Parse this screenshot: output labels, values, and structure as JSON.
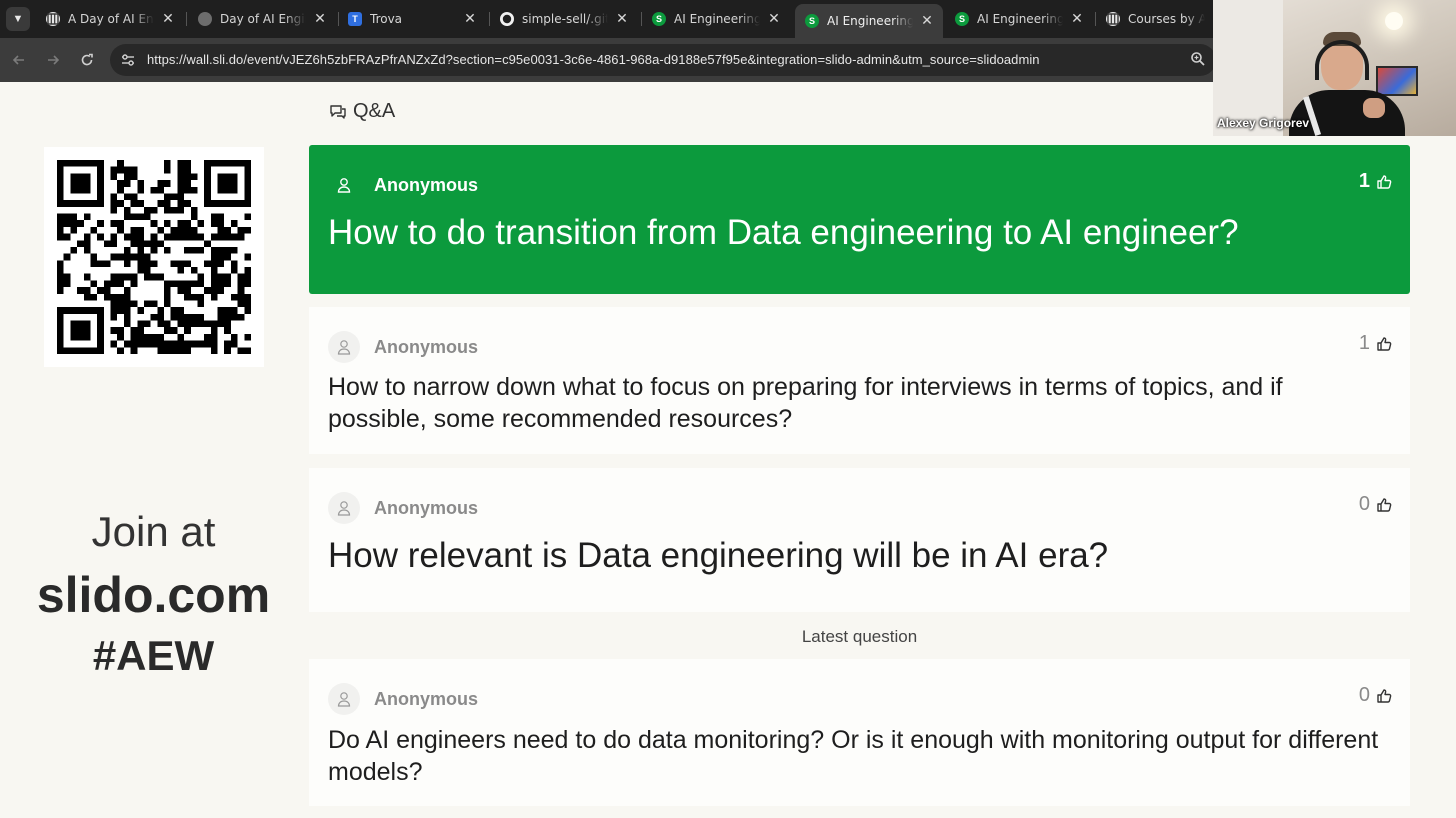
{
  "browser": {
    "tabs": [
      {
        "title": "A Day of AI Engineering",
        "favicon": "globe-grid"
      },
      {
        "title": "Day of AI Engineering",
        "favicon": "globe"
      },
      {
        "title": "Trova",
        "favicon": "T"
      },
      {
        "title": "simple-sell/.github",
        "favicon": "github"
      },
      {
        "title": "AI Engineering workshop",
        "favicon": "S"
      },
      {
        "title": "AI Engineering workshop",
        "favicon": "S"
      },
      {
        "title": "AI Engineering workshop",
        "favicon": "S"
      },
      {
        "title": "Courses by Alexey",
        "favicon": "globe-grid"
      }
    ],
    "url": "https://wall.sli.do/event/vJEZ6h5zbFRAzPfrANZxZd?section=c95e0031-3c6e-4861-968a-d9188e57f95e&integration=slido-admin&utm_source=slidoadmin",
    "colors": {
      "slido_green": "#0c9a3d",
      "chrome_dark": "#1f1f1f",
      "chrome_toolbar": "#3c3c3c"
    }
  },
  "webcam": {
    "name": "Alexey Grigorev"
  },
  "qa": {
    "title": "Q&A"
  },
  "join": {
    "line1": "Join at",
    "line2": "slido.com",
    "line3": "#AEW"
  },
  "questions": [
    {
      "author": "Anonymous",
      "likes": "1",
      "text": "How to do transition from Data engineering to AI engineer?"
    },
    {
      "author": "Anonymous",
      "likes": "1",
      "text": "How to narrow down what to focus on preparing for interviews in terms of topics, and if possible, some recommended resources?"
    },
    {
      "author": "Anonymous",
      "likes": "0",
      "text": "How relevant is Data engineering will be in AI era?"
    },
    {
      "author": "Anonymous",
      "likes": "0",
      "text": "Do AI engineers need to do data monitoring? Or is it enough with monitoring output for different models?"
    }
  ],
  "latest_label": "Latest question"
}
